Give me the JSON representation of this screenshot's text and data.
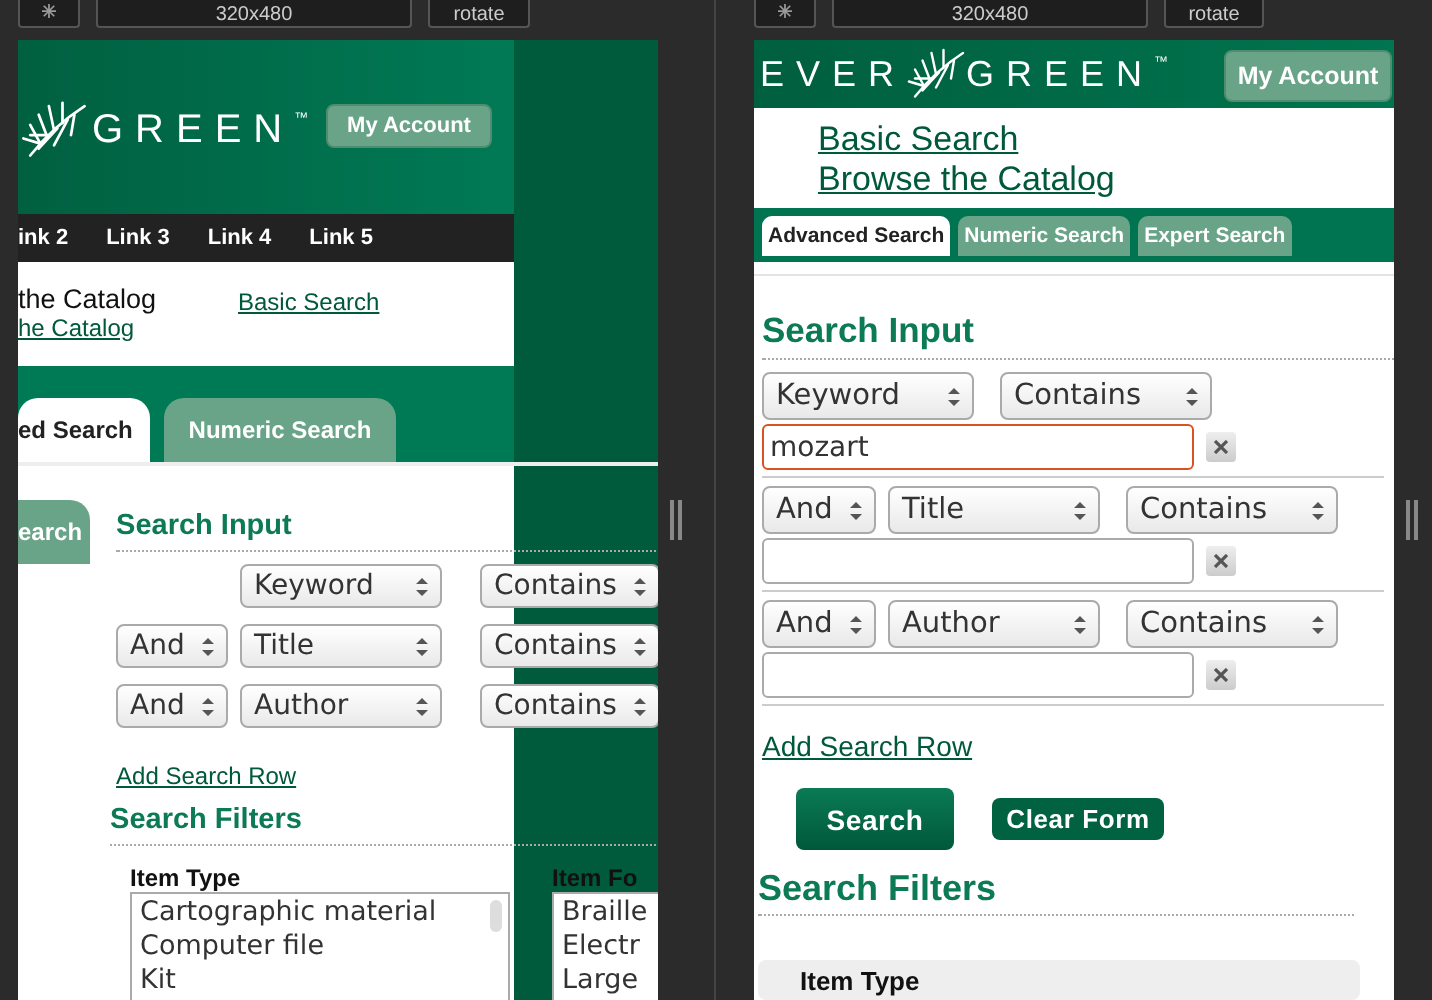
{
  "left_preview": {
    "toolbar": {
      "size": "320x480",
      "rotate": "rotate"
    },
    "logo_text": "GREEN",
    "logo_mark": "™",
    "account_button": "My Account",
    "nav_links": [
      "ink 2",
      "Link 3",
      "Link 4",
      "Link 5"
    ],
    "header_links": [
      {
        "label": "the Catalog",
        "kind": "current"
      },
      {
        "label": "he Catalog",
        "kind": "link"
      }
    ],
    "basic_search_link": "Basic Search",
    "tabs": [
      {
        "label": "ed Search",
        "selected": true
      },
      {
        "label": "Numeric Search",
        "selected": false
      }
    ],
    "side_tab": "earch",
    "search_input_heading": "Search Input",
    "rows": [
      {
        "field": "Keyword",
        "operator": "Contains"
      },
      {
        "boolean": "And",
        "field": "Title",
        "operator": "Contains"
      },
      {
        "boolean": "And",
        "field": "Author",
        "operator": "Contains"
      }
    ],
    "add_row_link": "Add Search Row",
    "filters_heading": "Search Filters",
    "filters": [
      {
        "label": "Item Type",
        "options": [
          "Cartographic material",
          "Computer file",
          "Kit"
        ]
      },
      {
        "label": "Item Fo",
        "options": [
          "Braille",
          "Electr",
          "Large"
        ]
      }
    ]
  },
  "right_preview": {
    "toolbar": {
      "size": "320x480",
      "rotate": "rotate"
    },
    "logo_text": [
      "EVER",
      "GREEN"
    ],
    "logo_mark": "™",
    "account_button": "My Account",
    "links": [
      "Basic Search",
      "Browse the Catalog"
    ],
    "tabs": [
      {
        "label": "Advanced Search",
        "selected": true
      },
      {
        "label": "Numeric Search",
        "selected": false
      },
      {
        "label": "Expert Search",
        "selected": false
      }
    ],
    "search_input_heading": "Search Input",
    "rows": [
      {
        "field": "Keyword",
        "operator": "Contains",
        "value": "mozart",
        "focused": true
      },
      {
        "boolean": "And",
        "field": "Title",
        "operator": "Contains",
        "focused": false
      },
      {
        "boolean": "And",
        "field": "Author",
        "operator": "Contains",
        "focused": false
      }
    ],
    "add_row_link": "Add Search Row",
    "buttons": [
      {
        "label": "Search",
        "kind": "primary"
      },
      {
        "label": "Clear Form",
        "kind": "secondary"
      }
    ],
    "filters_heading": "Search Filters",
    "filter_label": "Item Type"
  }
}
